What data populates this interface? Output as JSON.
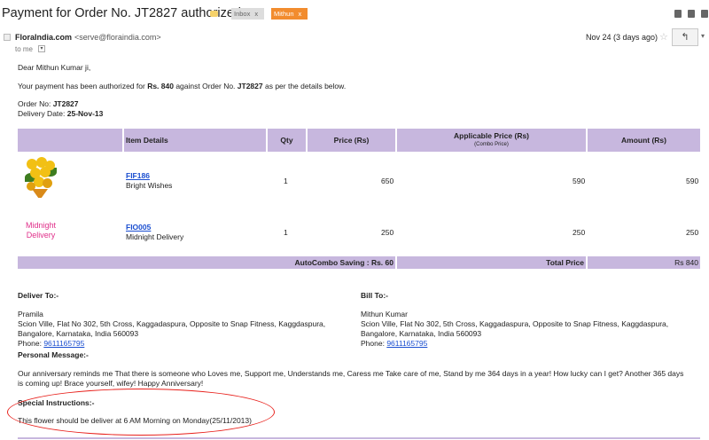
{
  "header": {
    "subject": "Payment for Order No. JT2827 authorized",
    "labels": [
      {
        "name": "Inbox",
        "close": "x",
        "color": "#dddddd"
      },
      {
        "name": "Mithun",
        "close": "x",
        "color": "#f28c2e"
      }
    ]
  },
  "sender": {
    "name": "FloraIndia.com",
    "email": "<serve@floraindia.com>",
    "to": "to me",
    "date": "Nov 24 (3 days ago)",
    "reply_icon": "reply-arrow-icon"
  },
  "message": {
    "greeting": "Dear Mithun Kumar ji,",
    "intro_prefix": "Your payment has been authorized for ",
    "amount": "Rs. 840",
    "intro_mid": " against Order No. ",
    "order_no": "JT2827",
    "intro_suffix": " as per the details below.",
    "order_label": "Order No: ",
    "delivery_label": "Delivery Date: ",
    "delivery_date": "25-Nov-13"
  },
  "table": {
    "headers": {
      "item": "Item Details",
      "qty": "Qty",
      "price": "Price (Rs)",
      "applicable": "Applicable Price (Rs)",
      "applicable_sub": "(Combo Price)",
      "amount": "Amount (Rs)"
    },
    "rows": [
      {
        "code": "FIF186",
        "name": "Bright Wishes",
        "qty": "1",
        "price": "650",
        "applicable": "590",
        "amount": "590"
      },
      {
        "side_label_1": "Midnight",
        "side_label_2": "Delivery",
        "code": "FIO005",
        "name": "Midnight Delivery",
        "qty": "1",
        "price": "250",
        "applicable": "250",
        "amount": "250"
      }
    ],
    "footer": {
      "saving": "AutoCombo Saving : Rs. 60",
      "total_label": "Total Price",
      "total": "Rs 840"
    }
  },
  "deliver_to": {
    "title": "Deliver To:-",
    "name": "Pramila",
    "line1": "Scion Ville, Flat No 302, 5th Cross, Kaggadaspura, Opposite to Snap Fitness, Kaggdaspura,",
    "line2": "Bangalore, Karnataka, India 560093",
    "phone_label": "Phone: ",
    "phone": "9611165795"
  },
  "bill_to": {
    "title": "Bill To:-",
    "name": "Mithun Kumar",
    "line1": "Scion Ville, Flat No 302, 5th Cross, Kaggadaspura, Opposite to Snap Fitness, Kaggdaspura,",
    "line2": "Bangalore, Karnataka, India 560093",
    "phone_label": "Phone: ",
    "phone": "9611165795"
  },
  "personal": {
    "title": "Personal Message:-",
    "line1": "Our anniversary reminds me That there is someone who Loves me, Support me, Understands me, Caress me Take care of me, Stand by me 364 days in a year! How lucky can I get? Another 365 days",
    "line2": "is coming up! Brace yourself, wifey! Happy Anniversary!"
  },
  "special": {
    "title": "Special Instructions:-",
    "text": "This flower should be deliver at 6 AM Morning on Monday(25/11/2013)"
  },
  "colors": {
    "table_header": "#c7b7de",
    "link": "#1a4ed0",
    "midnight_text": "#e0308a",
    "annotation_circle": "#e8211c"
  }
}
